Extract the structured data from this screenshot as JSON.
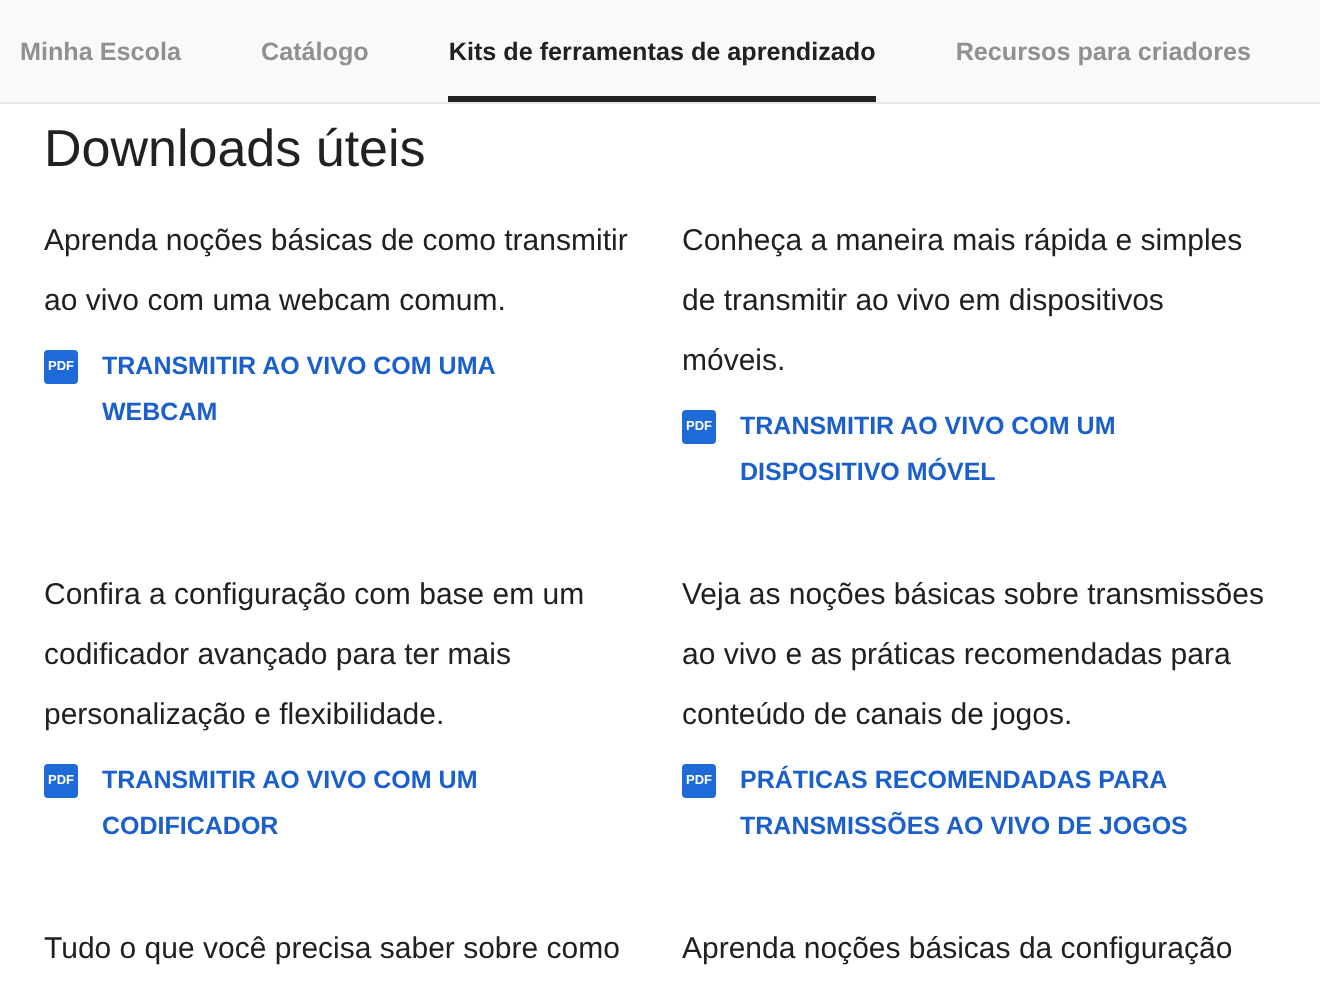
{
  "tabs": [
    {
      "label": "Minha Escola",
      "selected": false
    },
    {
      "label": "Catálogo",
      "selected": false
    },
    {
      "label": "Kits de ferramentas de aprendizado",
      "selected": true
    },
    {
      "label": "Recursos para criadores",
      "selected": false
    }
  ],
  "heading": "Downloads úteis",
  "cards": [
    {
      "description": "Aprenda noções básicas de como transmitir ao vivo com uma webcam comum.",
      "link": {
        "badge": "PDF",
        "label": "TRANSMITIR AO VIVO COM UMA WEBCAM"
      }
    },
    {
      "description": "Conheça a maneira mais rápida e simples de transmitir ao vivo em dispositivos móveis.",
      "link": {
        "badge": "PDF",
        "label": "TRANSMITIR AO VIVO COM UM DISPOSITIVO MÓVEL"
      }
    },
    {
      "description": "Confira a configuração com base em um codificador avançado para ter mais personalização e flexibilidade.",
      "link": {
        "badge": "PDF",
        "label": "TRANSMITIR AO VIVO COM UM CODIFICADOR"
      }
    },
    {
      "description": "Veja as noções básicas sobre transmissões ao vivo e as práticas recomendadas para conteúdo de canais de jogos.",
      "link": {
        "badge": "PDF",
        "label": "PRÁTICAS RECOMENDADAS PARA TRANSMISSÕES AO VIVO DE JOGOS"
      }
    },
    {
      "description": "Tudo o que você precisa saber sobre como"
    },
    {
      "description": "Aprenda noções básicas da configuração"
    }
  ]
}
